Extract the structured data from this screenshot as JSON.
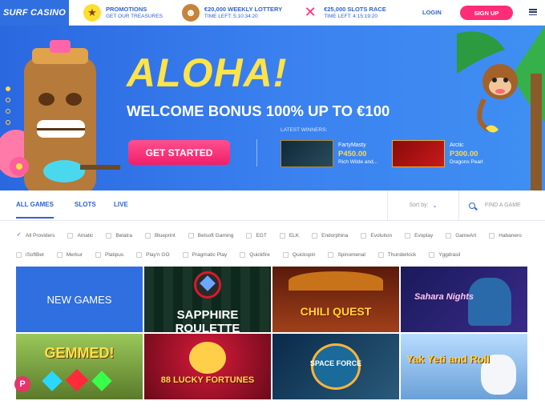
{
  "brand": {
    "logo_text": "SURF CASINO",
    "accent": "#2f6fe0",
    "pink": "#ff2d77"
  },
  "header": {
    "promos": [
      {
        "icon": "star-icon",
        "title": "PROMOTIONS",
        "subtitle": "GET OUR TREASURES"
      },
      {
        "icon": "tiki-icon",
        "title": "€20,000 WEEKLY LOTTERY",
        "subtitle": "TIME LEFT: 5:10:34:20"
      },
      {
        "icon": "x-race-icon",
        "title": "€25,000 SLOTS RACE",
        "subtitle": "TIME LEFT: 4:15:19:20"
      }
    ],
    "login_label": "LOGIN",
    "signup_label": "SIGN UP"
  },
  "hero": {
    "headline": "ALOHA!",
    "bonus": "WELCOME BONUS 100% UP TO €100",
    "cta": "GET STARTED",
    "latest_winners_label": "LATEST WINNERS:",
    "winners": [
      {
        "name": "FartyMasty",
        "amount": "P450.00",
        "game": "Rich Wilde and..."
      },
      {
        "name": "Arctic",
        "amount": "P300.00",
        "game": "Dragons Pearl"
      }
    ],
    "slider_active_index": 0,
    "slider_count": 4
  },
  "tabs": {
    "items": [
      "ALL GAMES",
      "SLOTS",
      "LIVE"
    ],
    "active": "ALL GAMES",
    "sort_label": "Sort by:",
    "search_placeholder": "FIND A GAME"
  },
  "providers": [
    {
      "name": "All Providers",
      "checked": true
    },
    {
      "name": "Amatic",
      "checked": false
    },
    {
      "name": "Belatra",
      "checked": false
    },
    {
      "name": "Blueprint",
      "checked": false
    },
    {
      "name": "Betsoft Gaming",
      "checked": false
    },
    {
      "name": "EGT",
      "checked": false
    },
    {
      "name": "ELK",
      "checked": false
    },
    {
      "name": "Endorphina",
      "checked": false
    },
    {
      "name": "Evolution",
      "checked": false
    },
    {
      "name": "Evoplay",
      "checked": false
    },
    {
      "name": "GameArt",
      "checked": false
    },
    {
      "name": "Habanero",
      "checked": false
    },
    {
      "name": "iSoftBet",
      "checked": false
    },
    {
      "name": "Merkur",
      "checked": false
    },
    {
      "name": "Platipus",
      "checked": false
    },
    {
      "name": "Play'n GO",
      "checked": false
    },
    {
      "name": "Pragmatic Play",
      "checked": false
    },
    {
      "name": "Quickfire",
      "checked": false
    },
    {
      "name": "Quickspin",
      "checked": false
    },
    {
      "name": "Spinomenal",
      "checked": false
    },
    {
      "name": "Thunderkick",
      "checked": false
    },
    {
      "name": "Yggdrasil",
      "checked": false
    }
  ],
  "games": {
    "new_games_label": "NEW GAMES",
    "tiles": [
      {
        "title": "SAPPHIRE ROULETTE",
        "bg": "#1a2a22"
      },
      {
        "title": "CHILI QUEST",
        "bg": "#7a2a1a"
      },
      {
        "title": "Sahara Nights",
        "bg": "#1a2a6a"
      },
      {
        "title": "GEMMED!",
        "bg": "#6a8a3a"
      },
      {
        "title": "88 LUCKY FORTUNES",
        "bg": "#b01a2a"
      },
      {
        "title": "SPACE FORCE",
        "bg": "#1a3a5a"
      },
      {
        "title": "Yak Yeti and Roll",
        "bg": "#8ab8e0"
      }
    ]
  }
}
